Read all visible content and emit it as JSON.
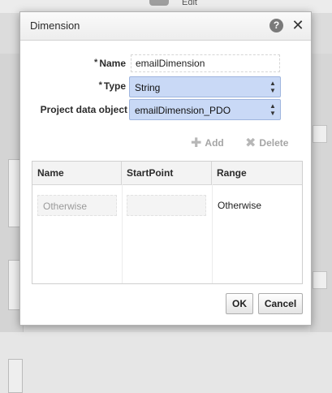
{
  "background": {
    "toolbar_label": "Edit"
  },
  "dialog": {
    "title": "Dimension",
    "help_glyph": "?",
    "close_glyph": "✕"
  },
  "form": {
    "name_label": "Name",
    "name_value": "emailDimension",
    "type_label": "Type",
    "type_value": "String",
    "pdo_label": "Project data object",
    "pdo_value": "emailDimension_PDO",
    "required_marker": "*"
  },
  "toolbar": {
    "add_label": "Add",
    "delete_label": "Delete"
  },
  "table": {
    "columns": [
      "Name",
      "StartPoint",
      "Range"
    ],
    "rows": [
      {
        "name_placeholder": "Otherwise",
        "startpoint": "",
        "range": "Otherwise"
      }
    ]
  },
  "footer": {
    "ok_label": "OK",
    "cancel_label": "Cancel"
  },
  "colors": {
    "select_background": "#c9d9f6",
    "disabled_text": "#a5a5a5"
  }
}
